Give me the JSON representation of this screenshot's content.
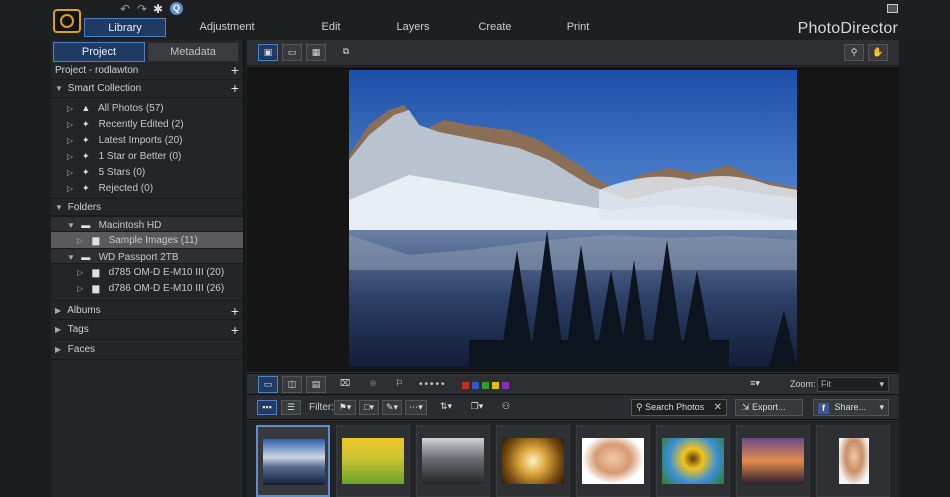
{
  "app": {
    "title": "PhotoDirector",
    "accent": "#4f7fc0",
    "logo_color": "#d9a21b"
  },
  "quick_access": {
    "undo": "↶",
    "redo": "↷",
    "settings": "✱",
    "help": "Q"
  },
  "module_tabs": [
    {
      "label": "Library",
      "active": true
    },
    {
      "label": "Adjustment"
    },
    {
      "label": "Edit"
    },
    {
      "label": "Layers"
    },
    {
      "label": "Create"
    },
    {
      "label": "Print"
    }
  ],
  "left_panel": {
    "tabs": [
      {
        "label": "Project",
        "active": true
      },
      {
        "label": "Metadata"
      }
    ],
    "project": "Project - rodlawton",
    "smart_collection": {
      "label": "Smart Collection",
      "items": [
        {
          "label": "All Photos (57)",
          "icon": "people-icon"
        },
        {
          "label": "Recently Edited (2)",
          "icon": "sparkle-icon"
        },
        {
          "label": "Latest Imports (20)",
          "icon": "sparkle-icon"
        },
        {
          "label": "1 Star or Better (0)",
          "icon": "sparkle-icon"
        },
        {
          "label": "5 Stars (0)",
          "icon": "sparkle-icon"
        },
        {
          "label": "Rejected (0)",
          "icon": "sparkle-icon"
        }
      ]
    },
    "folders": {
      "label": "Folders",
      "drives": [
        {
          "label": "Macintosh HD",
          "children": [
            "Sample Images (11)"
          ]
        },
        {
          "label": "WD Passport 2TB",
          "children": [
            "d785 OM-D E-M10 III (20)",
            "d786 OM-D E-M10 III (26)"
          ]
        }
      ]
    },
    "albums": "Albums",
    "tags": "Tags",
    "faces": "Faces"
  },
  "toolbar": {
    "zoom_label": "Zoom:",
    "zoom_value": "Fit",
    "filter_label": "Filter:",
    "search_placeholder": "Search Photos",
    "export_label": "Export...",
    "share_label": "Share...",
    "color_labels": [
      "#c0302a",
      "#3b56c4",
      "#2f9e3a",
      "#d8c01d",
      "#8a2fb5"
    ]
  }
}
